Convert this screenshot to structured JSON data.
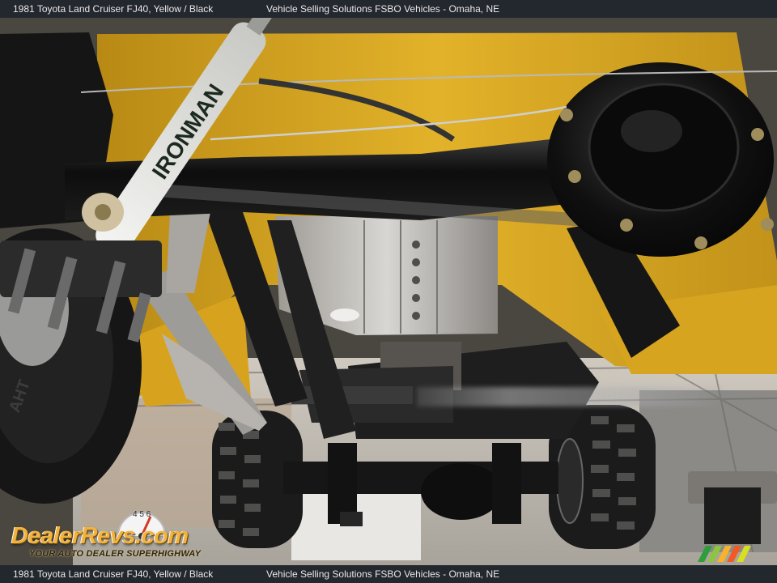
{
  "header": {
    "vehicle": "1981 Toyota Land Cruiser FJ40,  Yellow / Black",
    "seller": "Vehicle Selling Solutions FSBO Vehicles - Omaha, NE"
  },
  "footer": {
    "vehicle": "1981 Toyota Land Cruiser FJ40,  Yellow / Black",
    "seller": "Vehicle Selling Solutions FSBO Vehicles - Omaha, NE"
  },
  "photo": {
    "shock_brand": "IRONMAN",
    "tire_sidewall": "AHT"
  },
  "watermark": {
    "brand": "DealerRevs.com",
    "tagline": "YOUR AUTO DEALER SUPERHIGHWAY",
    "gauge_digits": "4 5 6"
  },
  "colors": {
    "bar_background": "#23272e",
    "bar_text": "#e9e9e9",
    "body_yellow": "#d9a520",
    "frame_black": "#141414",
    "logo_orange": "#f2b33d"
  },
  "icons": {
    "speedometer": "speedometer-icon",
    "stripes": "color-stripes-icon"
  }
}
